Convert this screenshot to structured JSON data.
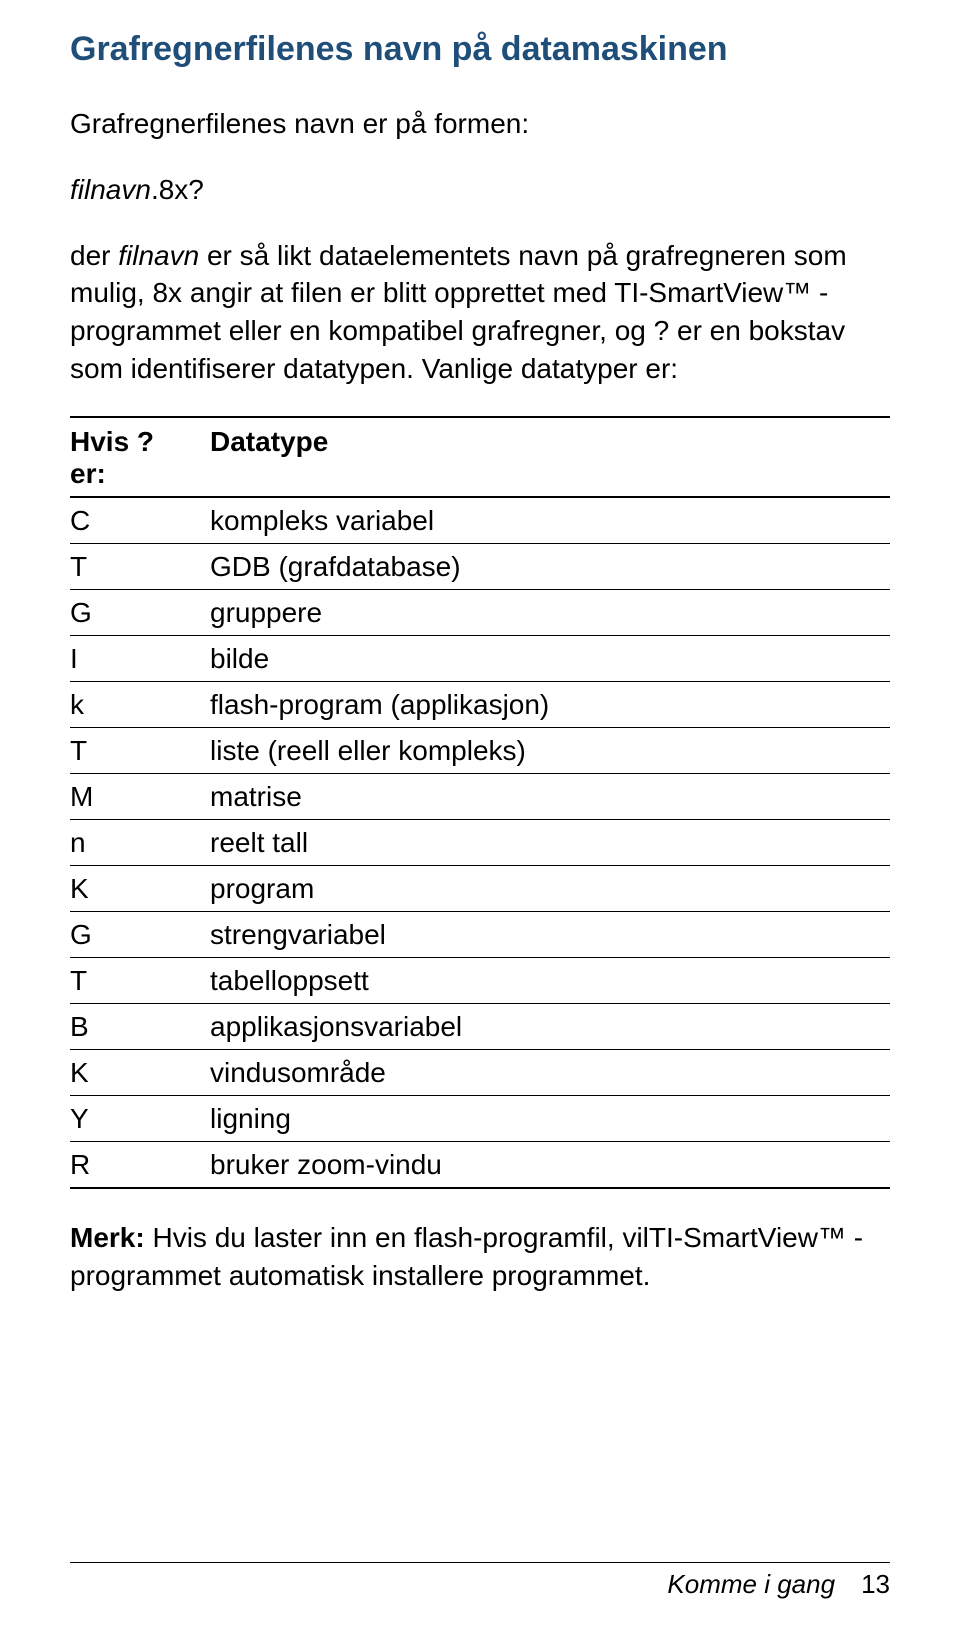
{
  "heading": "Grafregnerfilenes navn på datamaskinen",
  "intro": "Grafregnerfilenes navn er på formen:",
  "filename_pattern_pre": "filnavn",
  "filename_pattern_post": ".8x?",
  "body_pre": "der ",
  "body_filnavn": "filnavn",
  "body_mid": " er så likt dataelementets navn på grafregneren som mulig, 8x angir at filen er blitt opprettet med TI-SmartView™ -programmet eller en kompatibel grafregner, og ? er en bokstav som identifiserer datatypen. Vanlige datatyper er:",
  "table": {
    "header_left_line1": "Hvis ?",
    "header_left_line2": "er:",
    "header_right": "Datatype",
    "rows": [
      {
        "c": "C",
        "d": "kompleks variabel"
      },
      {
        "c": "T",
        "d": "GDB (grafdatabase)"
      },
      {
        "c": "G",
        "d": "gruppere"
      },
      {
        "c": "I",
        "d": "bilde"
      },
      {
        "c": "k",
        "d": "flash-program (applikasjon)"
      },
      {
        "c": "T",
        "d": "liste (reell eller kompleks)"
      },
      {
        "c": "M",
        "d": "matrise"
      },
      {
        "c": "n",
        "d": "reelt tall"
      },
      {
        "c": "K",
        "d": "program"
      },
      {
        "c": "G",
        "d": "strengvariabel"
      },
      {
        "c": "T",
        "d": "tabelloppsett"
      },
      {
        "c": "B",
        "d": "applikasjonsvariabel"
      },
      {
        "c": "K",
        "d": "vindusområde"
      },
      {
        "c": "Y",
        "d": "ligning"
      },
      {
        "c": "R",
        "d": "bruker zoom-vindu"
      }
    ]
  },
  "note_label": "Merk:",
  "note_text": " Hvis du laster inn en flash-programfil, vilTI-SmartView™ -programmet automatisk installere programmet.",
  "footer_title": "Komme i gang",
  "footer_page": "13"
}
